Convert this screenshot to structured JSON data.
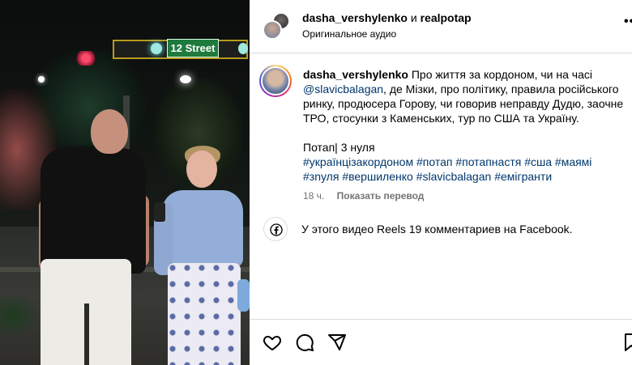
{
  "media": {
    "street_sign_text": "12 Street"
  },
  "header": {
    "author": "dasha_vershylenko",
    "connector": "и",
    "coauthor": "realpotap",
    "audio": "Оригинальное аудио",
    "more_icon": "more-dots-icon"
  },
  "caption": {
    "username": "dasha_vershylenko",
    "text_part1": " Про життя за кордоном, чи на часі ",
    "mention": "@slavicbalagan",
    "text_part2": ", де Мізки, про політику, правила російського ринку, продюсера Горову, чи говорив неправду Дудю, заочне ТРО, стосунки з Каменських, тур по США та Україну.",
    "line2": "Потап| 3 нуля",
    "hashtags": [
      "#українцізакордоном",
      "#потап",
      "#потапнастя",
      "#сша",
      "#маямі",
      "#зnуля",
      "#вершиленко",
      "#slavicbalagan",
      "#емігранти"
    ],
    "time": "18 ч.",
    "translate": "Показать перевод"
  },
  "facebook": {
    "icon": "facebook-icon",
    "text": "У этого видео Reels 19 комментариев на Facebook."
  },
  "actions": {
    "like_icon": "heart-icon",
    "comment_icon": "comment-icon",
    "share_icon": "send-icon",
    "save_icon": "bookmark-icon"
  },
  "colors": {
    "link": "#00376b",
    "muted": "#737373",
    "border": "#dbdbdb"
  }
}
